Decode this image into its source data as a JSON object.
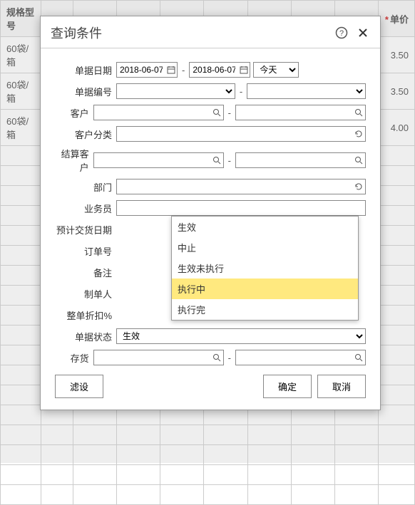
{
  "bg": {
    "col_spec": "规格型号",
    "col_price": "单价",
    "rows": [
      {
        "spec": "60袋/箱",
        "price": "3.50"
      },
      {
        "spec": "60袋/箱",
        "price": "3.50"
      },
      {
        "spec": "60袋/箱",
        "price": "4.00"
      }
    ]
  },
  "modal": {
    "title": "查询条件",
    "labels": {
      "doc_date": "单据日期",
      "doc_no": "单据编号",
      "customer": "客户",
      "cust_class": "客户分类",
      "settle_cust": "结算客户",
      "dept": "部门",
      "salesman": "业务员",
      "expect_date": "预计交货日期",
      "order_no": "订单号",
      "remark": "备注",
      "maker": "制单人",
      "discount": "整单折扣%",
      "status": "单据状态",
      "inventory": "存货"
    },
    "date_from": "2018-06-07",
    "date_to": "2018-06-07",
    "date_preset": "今天",
    "sep": "-",
    "status_value": "生效",
    "buttons": {
      "filter": "滤设",
      "ok": "确定",
      "cancel": "取消"
    }
  },
  "dropdown": {
    "items": [
      "生效",
      "中止",
      "生效未执行",
      "执行中",
      "执行完"
    ],
    "highlight_index": 3
  }
}
